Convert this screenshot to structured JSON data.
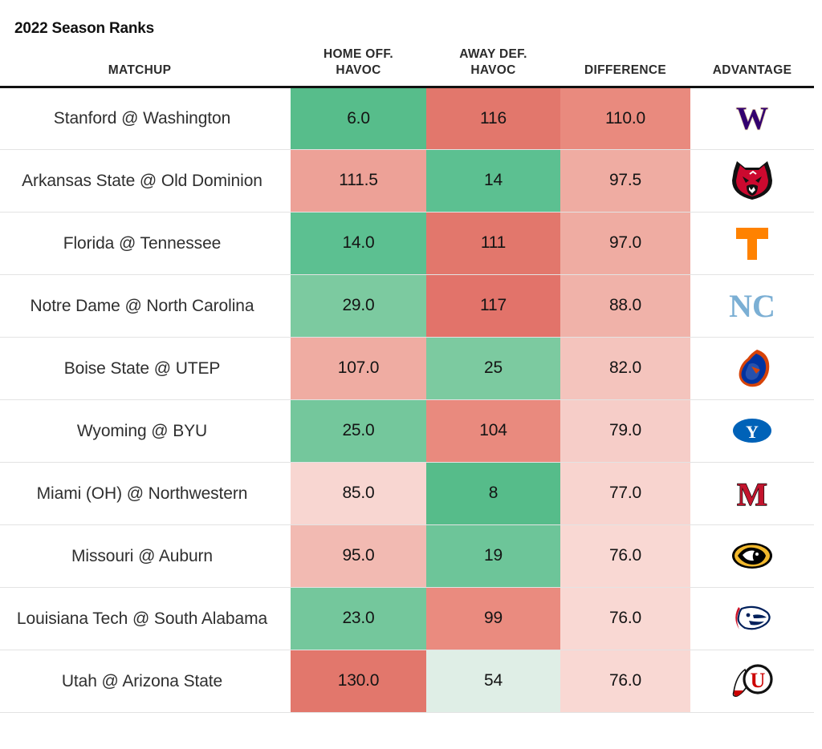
{
  "title": "2022 Season Ranks",
  "columns": {
    "matchup": "MATCHUP",
    "home_off_havoc_line1": "HOME OFF.",
    "home_off_havoc_line2": "HAVOC",
    "away_def_havoc_line1": "AWAY DEF.",
    "away_def_havoc_line2": "HAVOC",
    "difference": "DIFFERENCE",
    "advantage": "ADVANTAGE"
  },
  "colors": {
    "green_strong": "#57bd8b",
    "green_mid": "#7ccaa0",
    "green_light": "#dfeee6",
    "red_strong": "#e2776c",
    "red_mid": "#eda197",
    "red_light": "#f9d8d4",
    "header_rule": "#111111",
    "row_rule": "#e3e3e3"
  },
  "chart_data": {
    "type": "table",
    "title": "2022 Season Ranks",
    "columns": [
      "MATCHUP",
      "HOME OFF. HAVOC",
      "AWAY DEF. HAVOC",
      "DIFFERENCE",
      "ADVANTAGE"
    ],
    "rows": [
      {
        "matchup": "Stanford @ Washington",
        "home_off_havoc": "6.0",
        "away_def_havoc": "116",
        "difference": "110.0",
        "advantage_team": "Washington Huskies",
        "advantage_logo": "washington-huskies-logo",
        "home_color": "#57bd8b",
        "away_color": "#e2776c",
        "diff_color": "#e98a7e"
      },
      {
        "matchup": "Arkansas State @ Old Dominion",
        "home_off_havoc": "111.5",
        "away_def_havoc": "14",
        "difference": "97.5",
        "advantage_team": "Arkansas State Red Wolves",
        "advantage_logo": "arkansas-state-red-wolves-logo",
        "home_color": "#eda197",
        "away_color": "#5cc091",
        "diff_color": "#efaca2"
      },
      {
        "matchup": "Florida @ Tennessee",
        "home_off_havoc": "14.0",
        "away_def_havoc": "111",
        "difference": "97.0",
        "advantage_team": "Tennessee Volunteers",
        "advantage_logo": "tennessee-volunteers-logo",
        "home_color": "#5cc091",
        "away_color": "#e2776c",
        "diff_color": "#efaca2"
      },
      {
        "matchup": "Notre Dame @ North Carolina",
        "home_off_havoc": "29.0",
        "away_def_havoc": "117",
        "difference": "88.0",
        "advantage_team": "North Carolina Tar Heels",
        "advantage_logo": "north-carolina-tar-heels-logo",
        "home_color": "#7ccaa0",
        "away_color": "#e2736a",
        "diff_color": "#f0b2a9"
      },
      {
        "matchup": "Boise State @ UTEP",
        "home_off_havoc": "107.0",
        "away_def_havoc": "25",
        "difference": "82.0",
        "advantage_team": "Boise State Broncos",
        "advantage_logo": "boise-state-broncos-logo",
        "home_color": "#efaca2",
        "away_color": "#7ccaa0",
        "diff_color": "#f4c4bd"
      },
      {
        "matchup": "Wyoming @ BYU",
        "home_off_havoc": "25.0",
        "away_def_havoc": "104",
        "difference": "79.0",
        "advantage_team": "BYU Cougars",
        "advantage_logo": "byu-cougars-logo",
        "home_color": "#74c79c",
        "away_color": "#e98a7e",
        "diff_color": "#f6cdc8"
      },
      {
        "matchup": "Miami (OH) @ Northwestern",
        "home_off_havoc": "85.0",
        "away_def_havoc": "8",
        "difference": "77.0",
        "advantage_team": "Miami RedHawks",
        "advantage_logo": "miami-ohio-redhawks-logo",
        "home_color": "#f8d6d1",
        "away_color": "#56bc8a",
        "diff_color": "#f8d4cf"
      },
      {
        "matchup": "Missouri @ Auburn",
        "home_off_havoc": "95.0",
        "away_def_havoc": "19",
        "difference": "76.0",
        "advantage_team": "Missouri Tigers",
        "advantage_logo": "missouri-tigers-logo",
        "home_color": "#f2bab2",
        "away_color": "#6dc599",
        "diff_color": "#f9d8d3"
      },
      {
        "matchup": "Louisiana Tech @ South Alabama",
        "home_off_havoc": "23.0",
        "away_def_havoc": "99",
        "difference": "76.0",
        "advantage_team": "South Alabama Jaguars",
        "advantage_logo": "south-alabama-jaguars-logo",
        "home_color": "#74c79c",
        "away_color": "#ea8b7f",
        "diff_color": "#f9d8d3"
      },
      {
        "matchup": "Utah @ Arizona State",
        "home_off_havoc": "130.0",
        "away_def_havoc": "54",
        "difference": "76.0",
        "advantage_team": "Utah Utes",
        "advantage_logo": "utah-utes-logo",
        "home_color": "#e2776c",
        "away_color": "#dfeee6",
        "diff_color": "#f9d8d3"
      }
    ]
  }
}
